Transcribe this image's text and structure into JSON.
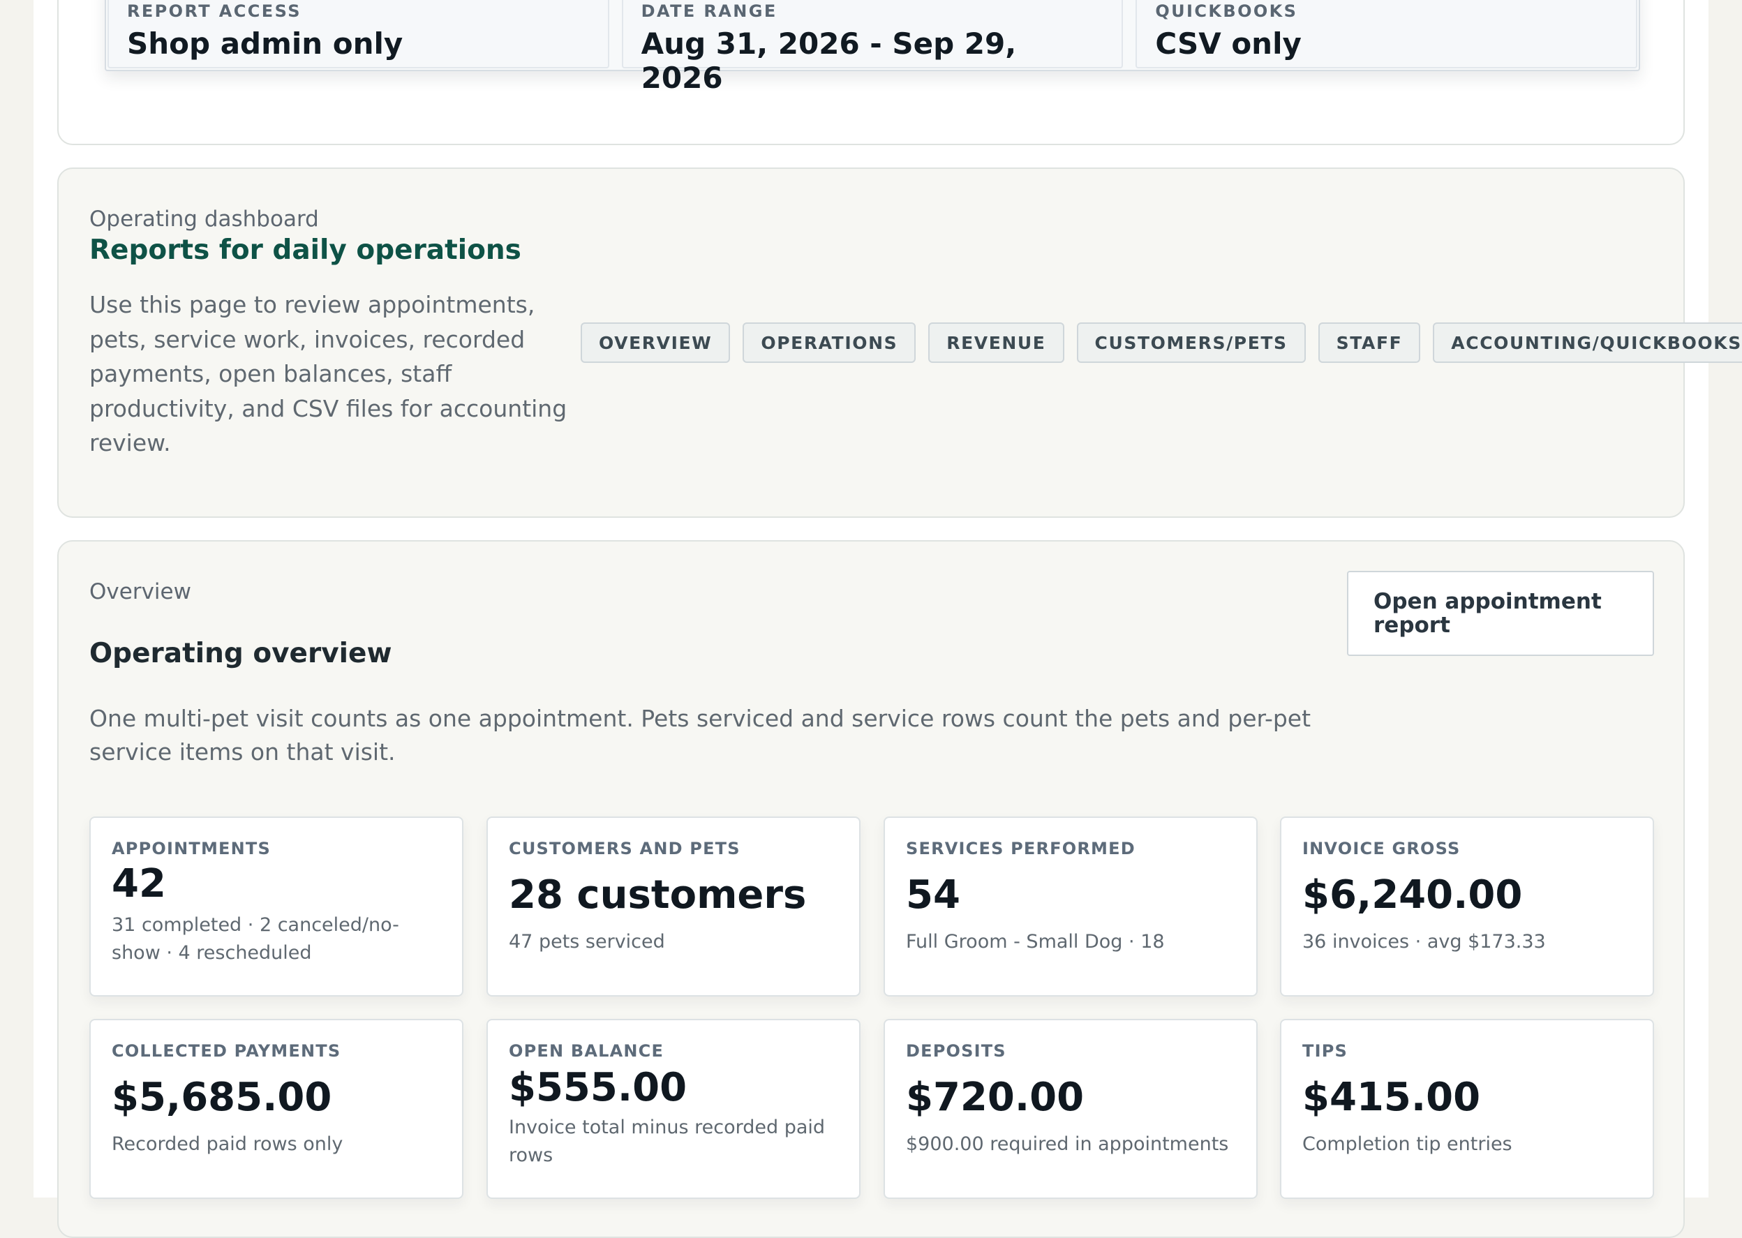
{
  "summary": [
    {
      "label": "REPORT ACCESS",
      "value": "Shop admin only"
    },
    {
      "label": "DATE RANGE",
      "value": "Aug 31, 2026 - Sep 29, 2026"
    },
    {
      "label": "QUICKBOOKS",
      "value": "CSV only"
    }
  ],
  "dashboard": {
    "eyebrow": "Operating dashboard",
    "title": "Reports for daily operations",
    "description": "Use this page to review appointments, pets, service work, invoices, recorded payments, open balances, staff productivity, and CSV files for accounting review.",
    "tabs": [
      "OVERVIEW",
      "OPERATIONS",
      "REVENUE",
      "CUSTOMERS/PETS",
      "STAFF",
      "ACCOUNTING/QUICKBOOKS"
    ]
  },
  "overview": {
    "eyebrow": "Overview",
    "title": "Operating overview",
    "description": "One multi-pet visit counts as one appointment. Pets serviced and service rows count the pets and per-pet service items on that visit.",
    "button_label": "Open appointment report",
    "metrics": [
      {
        "label": "APPOINTMENTS",
        "value": "42",
        "sub": "31 completed · 2 canceled/no-show · 4 rescheduled"
      },
      {
        "label": "CUSTOMERS AND PETS",
        "value": "28 customers",
        "sub": "47 pets serviced"
      },
      {
        "label": "SERVICES PERFORMED",
        "value": "54",
        "sub": "Full Groom - Small Dog · 18"
      },
      {
        "label": "INVOICE GROSS",
        "value": "$6,240.00",
        "sub": "36 invoices · avg $173.33"
      },
      {
        "label": "COLLECTED PAYMENTS",
        "value": "$5,685.00",
        "sub": "Recorded paid rows only"
      },
      {
        "label": "OPEN BALANCE",
        "value": "$555.00",
        "sub": "Invoice total minus recorded paid rows"
      },
      {
        "label": "DEPOSITS",
        "value": "$720.00",
        "sub": "$900.00 required in appointments"
      },
      {
        "label": "TIPS",
        "value": "$415.00",
        "sub": "Completion tip entries"
      }
    ]
  }
}
